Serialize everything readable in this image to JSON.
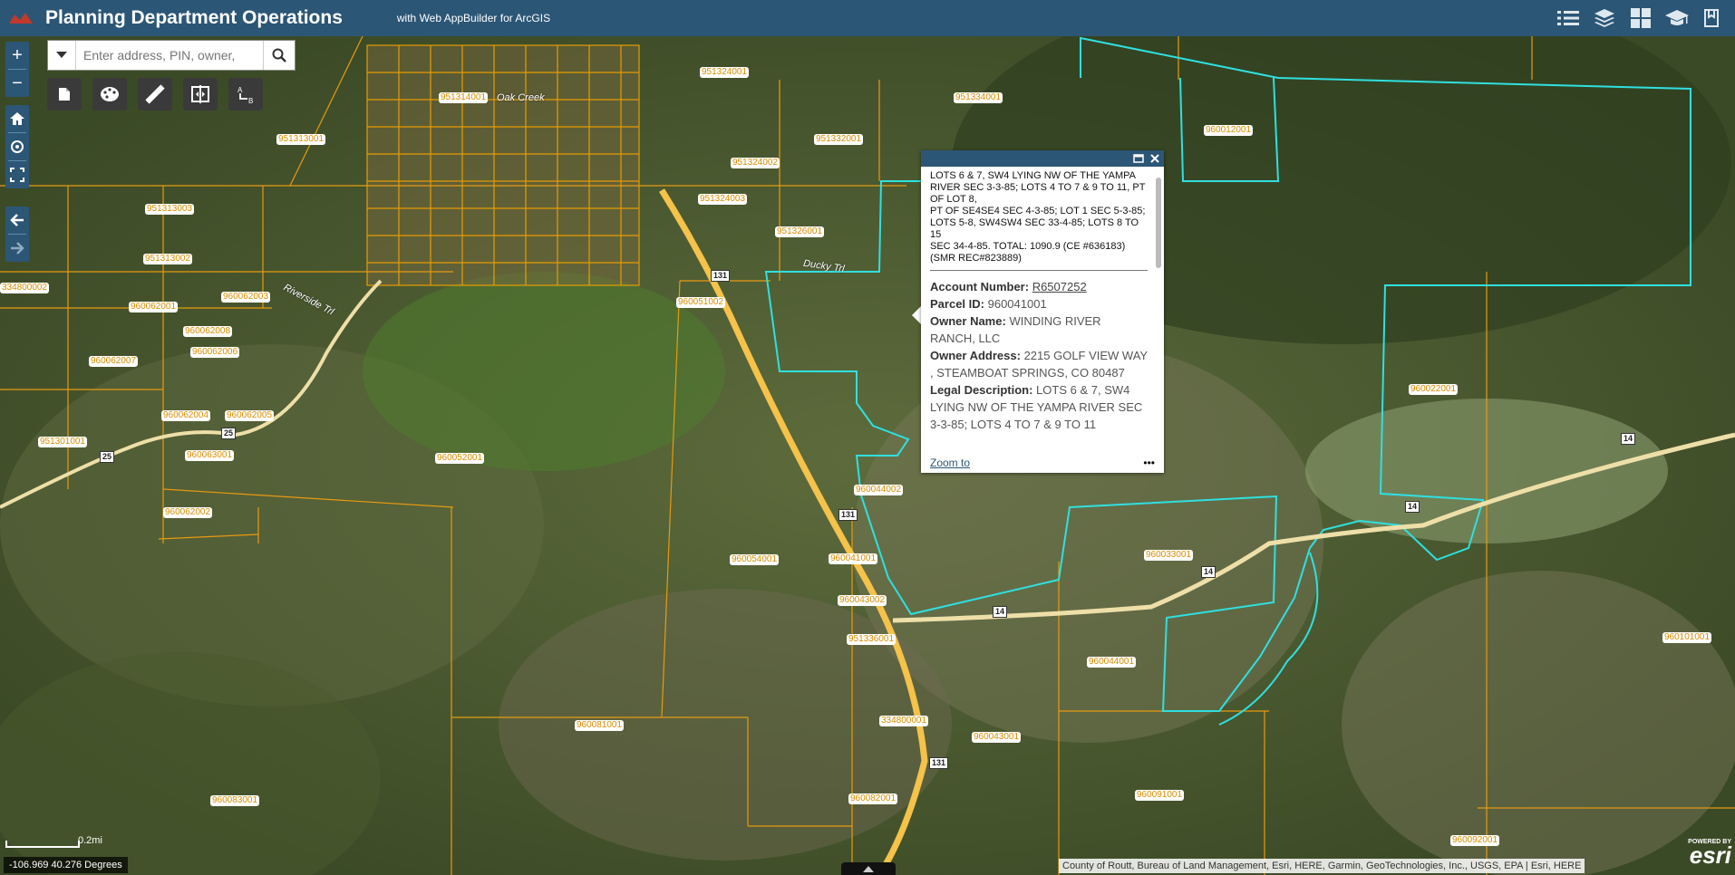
{
  "header": {
    "title": "Planning Department Operations",
    "subtitle": "with Web AppBuilder for ArcGIS",
    "tools": [
      "list-icon",
      "layers-icon",
      "basemap-gallery-icon",
      "about-icon",
      "bookmark-icon"
    ]
  },
  "search": {
    "placeholder": "Enter address, PIN, owner,"
  },
  "map_controls": {
    "zoom_in": "+",
    "zoom_out": "−"
  },
  "widgets": [
    "print-icon",
    "draw-icon",
    "measure-icon",
    "swipe-icon",
    "directions-icon"
  ],
  "popup": {
    "title_lines": [
      "LOTS 6 & 7, SW4 LYING NW OF THE YAMPA RIVER SEC 3-3-85; LOTS 4 TO 7 & 9 TO 11, PT OF LOT 8,",
      "PT OF SE4SE4 SEC 4-3-85; LOT 1 SEC 5-3-85; LOTS 5-8, SW4SW4 SEC 33-4-85; LOTS 8 TO 15",
      "SEC 34-4-85. TOTAL: 1090.9 (CE #636183) (SMR REC#823889)"
    ],
    "account_label": "Account Number:",
    "account_value": "R6507252",
    "parcel_label": "Parcel ID:",
    "parcel_value": "960041001",
    "owner_label": "Owner Name:",
    "owner_value": "WINDING RIVER RANCH, LLC",
    "address_label": "Owner Address:",
    "address_value": "2215 GOLF VIEW WAY , STEAMBOAT SPRINGS, CO 80487",
    "legal_label": "Legal Description:",
    "legal_value": "LOTS 6 & 7, SW4 LYING NW OF THE YAMPA RIVER SEC 3-3-85; LOTS 4 TO 7 & 9 TO 11",
    "zoom_to": "Zoom to",
    "more": "•••"
  },
  "parcels": [
    "951313003",
    "951313002",
    "951313001",
    "960062001",
    "960062003",
    "960062008",
    "960062006",
    "960062007",
    "960062004",
    "960062005",
    "960063001",
    "960062002",
    "960052001",
    "960051002",
    "960054001",
    "960041001",
    "960043002",
    "960043001",
    "960081001",
    "960083001",
    "960082001",
    "960091001",
    "960092001",
    "960101001",
    "960022001",
    "960033001",
    "960044001",
    "960044002",
    "960012001",
    "951334001",
    "951332001",
    "951324001",
    "951324002",
    "951324003",
    "951326001",
    "951336001",
    "334800001",
    "334800002",
    "951301001",
    "951314001"
  ],
  "road_labels": {
    "ducky": "Ducky Trl",
    "riverside": "Riverside Trl",
    "oak_creek": "Oak Creek"
  },
  "shields": {
    "h131": "131",
    "h14": "14",
    "h25": "25"
  },
  "scale": "0.2mi",
  "coords": "-106.969 40.276 Degrees",
  "attribution": "County of Routt, Bureau of Land Management, Esri, HERE, Garmin, GeoTechnologies, Inc., USGS, EPA | Esri, HERE",
  "esri": {
    "powered_by": "POWERED BY",
    "logo": "esri"
  }
}
